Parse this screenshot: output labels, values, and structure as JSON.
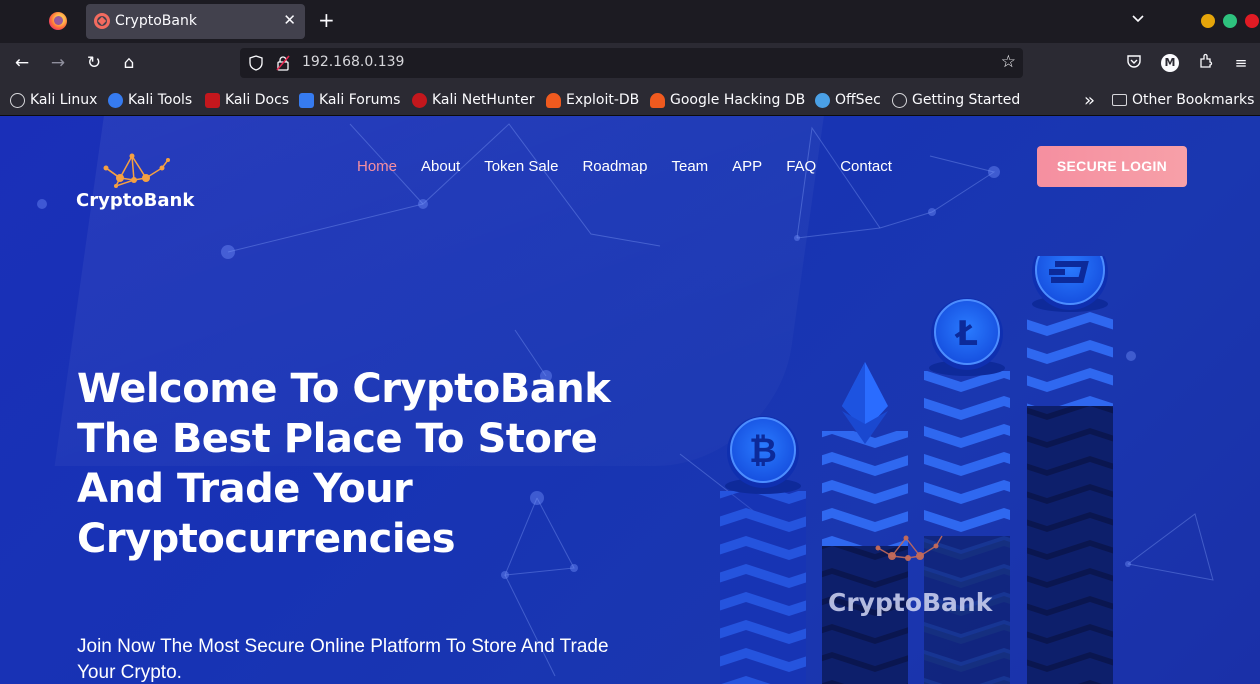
{
  "browser": {
    "tab_title": "CryptoBank",
    "url": "192.168.0.139",
    "profile_initial": "M",
    "bookmarks": [
      {
        "label": "Kali Linux",
        "icon": "kali-dragon-icon",
        "color": "#d7d7db"
      },
      {
        "label": "Kali Tools",
        "icon": "kali-tools-icon",
        "color": "#367bf0"
      },
      {
        "label": "Kali Docs",
        "icon": "kali-docs-icon",
        "color": "#c4171d"
      },
      {
        "label": "Kali Forums",
        "icon": "kali-forums-icon",
        "color": "#367bf0"
      },
      {
        "label": "Kali NetHunter",
        "icon": "kali-nethunter-icon",
        "color": "#c4171d"
      },
      {
        "label": "Exploit-DB",
        "icon": "exploit-db-icon",
        "color": "#ef5a1f"
      },
      {
        "label": "Google Hacking DB",
        "icon": "ghdb-icon",
        "color": "#ef5a1f"
      },
      {
        "label": "OffSec",
        "icon": "offsec-icon",
        "color": "#4aa0e6"
      },
      {
        "label": "Getting Started",
        "icon": "globe-icon",
        "color": "#d7d7db"
      }
    ],
    "overflow_label": "»",
    "other_bookmarks": "Other Bookmarks"
  },
  "site": {
    "logo_text": "CryptoBank",
    "menu": [
      "Home",
      "About",
      "Token Sale",
      "Roadmap",
      "Team",
      "APP",
      "FAQ",
      "Contact"
    ],
    "active_menu": "Home",
    "login_label": "SECURE LOGIN",
    "headline": "Welcome To CryptoBank The Best Place To Store And Trade Your Cryptocurrencies",
    "subline": "Join Now The Most Secure Online Platform To Store And Trade Your Crypto.",
    "illustration_brand": "CryptoBank",
    "coins": [
      "bitcoin-coin-icon",
      "ethereum-diamond-icon",
      "litecoin-coin-icon",
      "dash-coin-icon"
    ],
    "colors": {
      "accent": "#f58fa0",
      "background": "#1733b4",
      "text": "#ffffff"
    }
  }
}
